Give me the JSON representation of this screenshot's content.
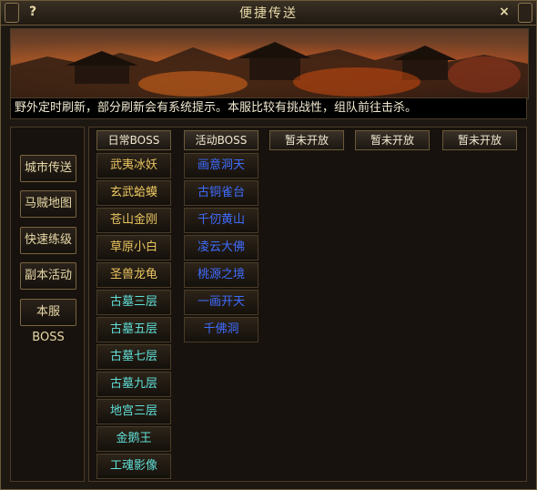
{
  "window": {
    "title": "便捷传送",
    "help_label": "?",
    "close_label": "×"
  },
  "notice": "野外定时刷新，部分刷新会有系统提示。本服比较有挑战性，组队前往击杀。",
  "sidebar": {
    "items": [
      {
        "label": "城市传送"
      },
      {
        "label": "马贼地图"
      },
      {
        "label": "快速练级"
      },
      {
        "label": "副本活动"
      },
      {
        "label": "本服BOSS"
      }
    ]
  },
  "tabs": [
    {
      "label": "日常BOSS"
    },
    {
      "label": "活动BOSS"
    },
    {
      "label": "暂未开放"
    },
    {
      "label": "暂未开放"
    },
    {
      "label": "暂未开放"
    }
  ],
  "daily_boss": [
    {
      "label": "武夷冰妖",
      "color": "gold"
    },
    {
      "label": "玄武蛤蟆",
      "color": "gold"
    },
    {
      "label": "苍山金刚",
      "color": "gold"
    },
    {
      "label": "草原小白",
      "color": "gold"
    },
    {
      "label": "圣兽龙龟",
      "color": "gold"
    },
    {
      "label": "古墓三层",
      "color": "cyan"
    },
    {
      "label": "古墓五层",
      "color": "cyan"
    },
    {
      "label": "古墓七层",
      "color": "cyan"
    },
    {
      "label": "古墓九层",
      "color": "cyan"
    },
    {
      "label": "地宫三层",
      "color": "cyan"
    },
    {
      "label": "金鹅王",
      "color": "cyan"
    },
    {
      "label": "工魂影像",
      "color": "cyan"
    }
  ],
  "event_boss": [
    {
      "label": "画意洞天"
    },
    {
      "label": "古铜雀台"
    },
    {
      "label": "千仞黄山"
    },
    {
      "label": "凌云大佛"
    },
    {
      "label": "桃源之境"
    },
    {
      "label": "一画开天"
    },
    {
      "label": "千佛洞"
    }
  ],
  "colors": {
    "gold": "#e8c460",
    "cyan": "#5fe0d8",
    "blue": "#3f6cff",
    "frame": "#6b5a3a"
  }
}
